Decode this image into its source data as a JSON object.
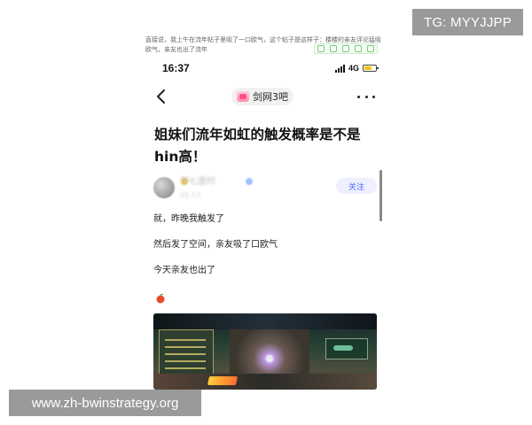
{
  "top_caption": "直接说，我上午在流年帖子里吸了一口欧气，这个帖子是这样子：楼楼的亲友评论猛吸欧气，亲友也出了流年",
  "watermark": {
    "tg": "TG: MYYJJPP",
    "site": "www.zh-bwinstrategy.org"
  },
  "status_bar": {
    "time": "16:37",
    "network": "4G"
  },
  "nav": {
    "forum_name": "剑网3吧"
  },
  "post": {
    "title": "姐妹们流年如虹的触发概率是不是hin高！",
    "author_name": "学七恩时",
    "author_level": "25.13",
    "follow_label": "关注",
    "body": [
      "就，昨晚我触发了",
      "然后发了空间，亲友吸了口欧气",
      "今天亲友也出了"
    ]
  },
  "icons": {
    "back": "back-arrow-icon",
    "more": "more-icon",
    "apple": "apple-icon"
  }
}
